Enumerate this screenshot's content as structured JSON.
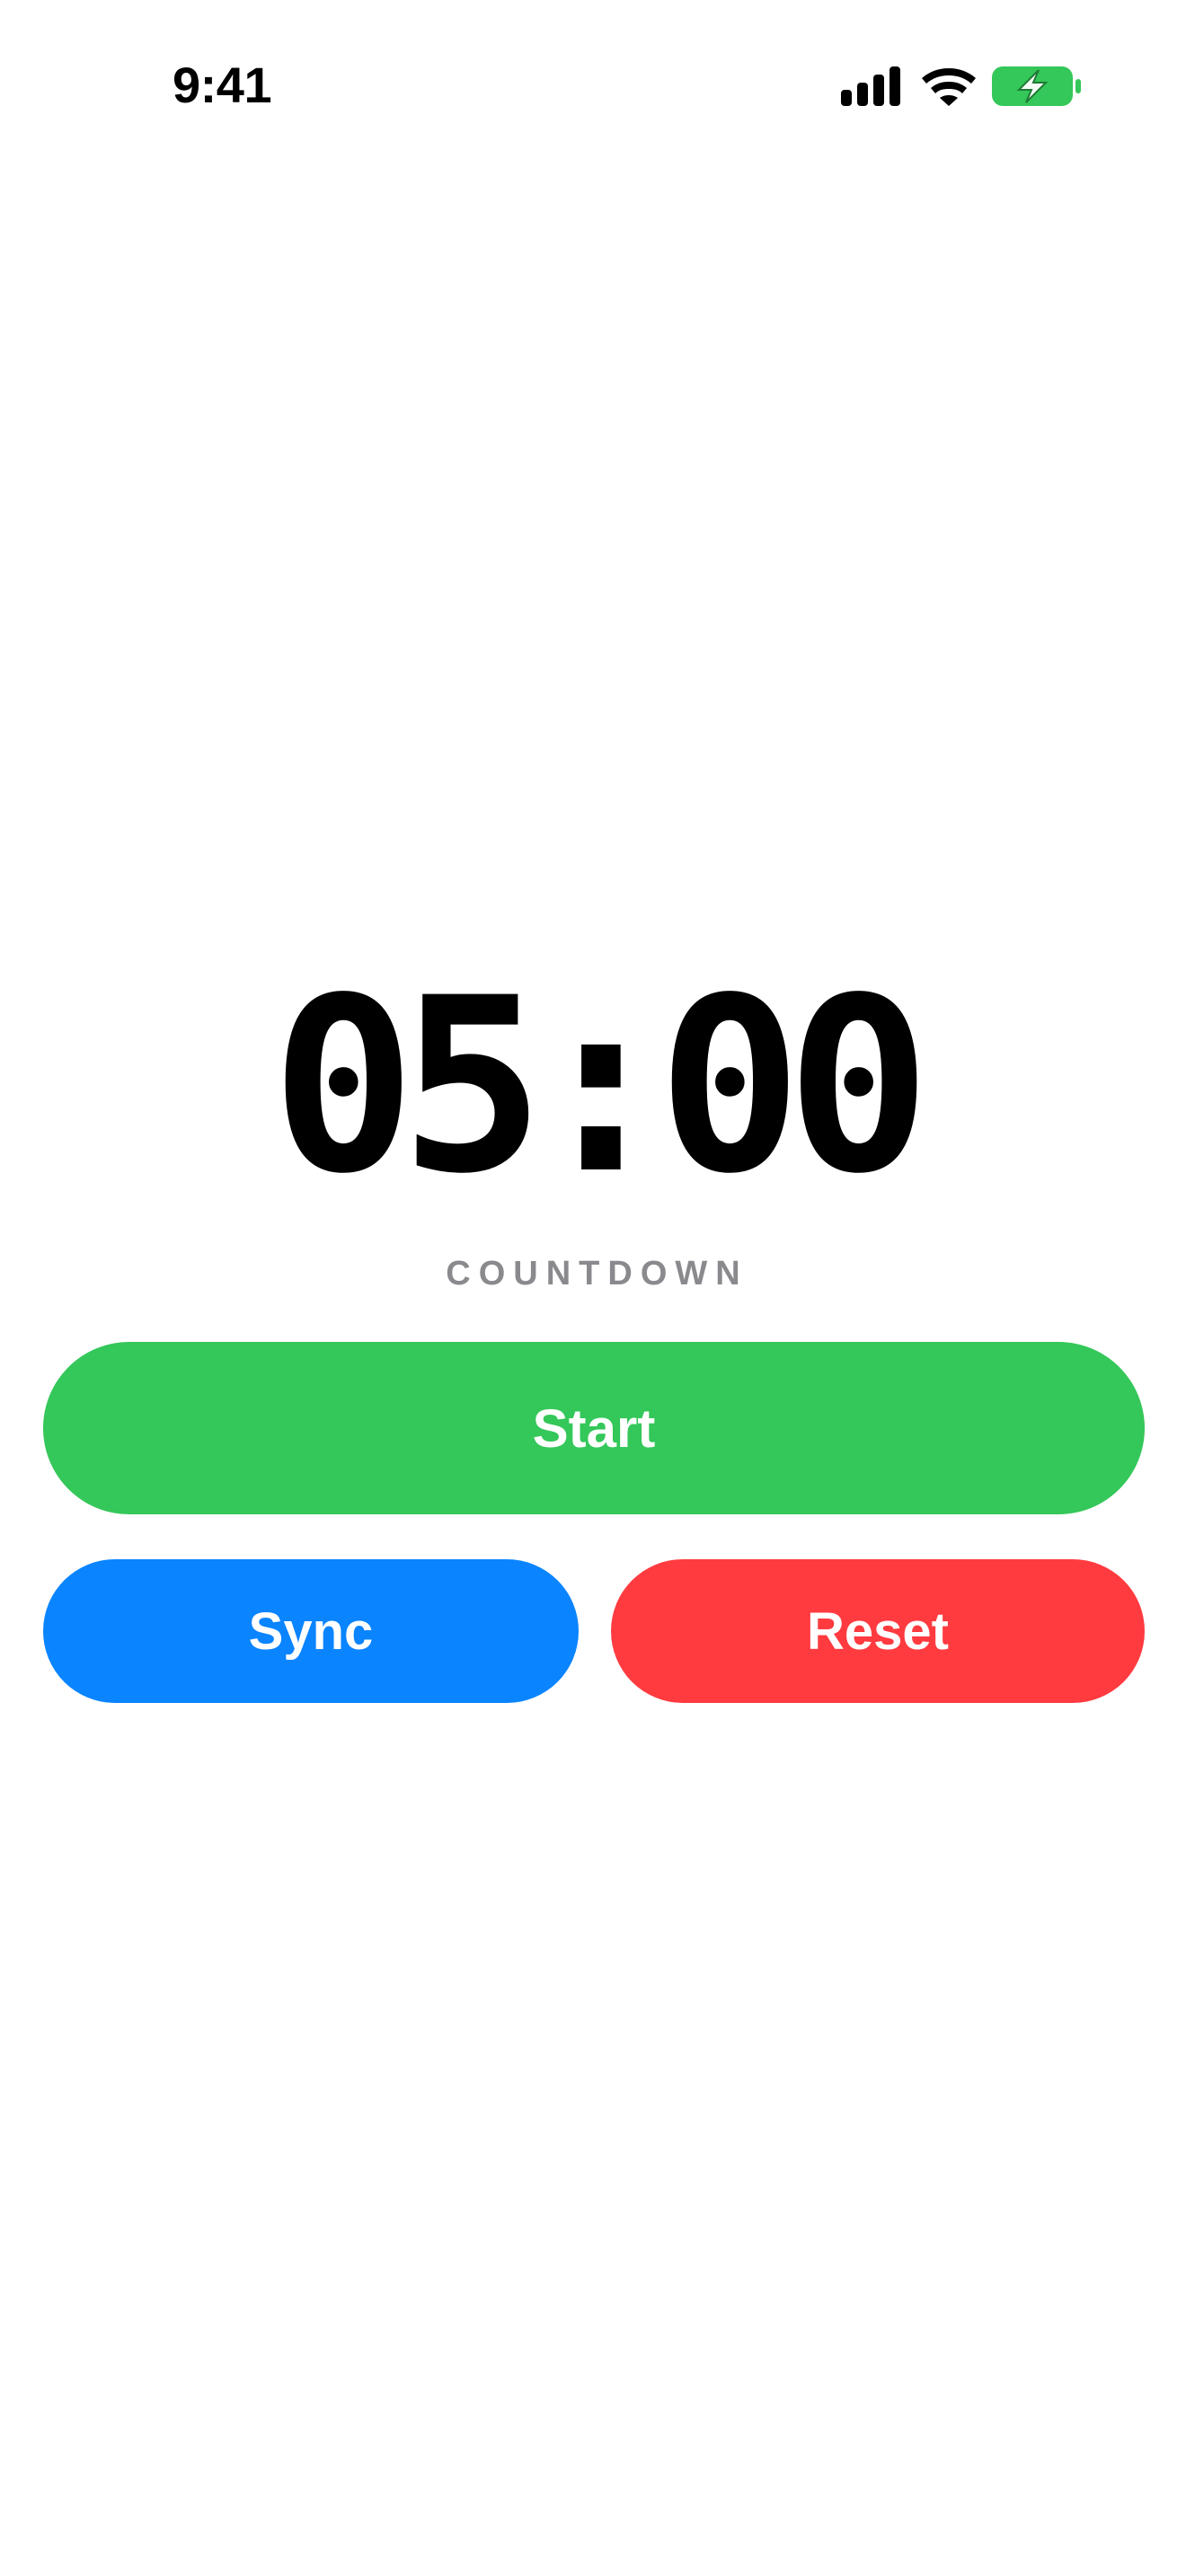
{
  "status_bar": {
    "time": "9:41",
    "icons": [
      "signal-icon",
      "wifi-icon",
      "battery-charging-icon"
    ],
    "battery_color": "#34c759"
  },
  "timer": {
    "display": "05:00",
    "label": "COUNTDOWN"
  },
  "buttons": {
    "start": {
      "label": "Start",
      "color": "#34c759"
    },
    "sync": {
      "label": "Sync",
      "color": "#0a84ff"
    },
    "reset": {
      "label": "Reset",
      "color": "#ff3b40"
    }
  },
  "colors": {
    "background": "#ffffff",
    "label_gray": "#8a8a8e",
    "text": "#000000"
  }
}
